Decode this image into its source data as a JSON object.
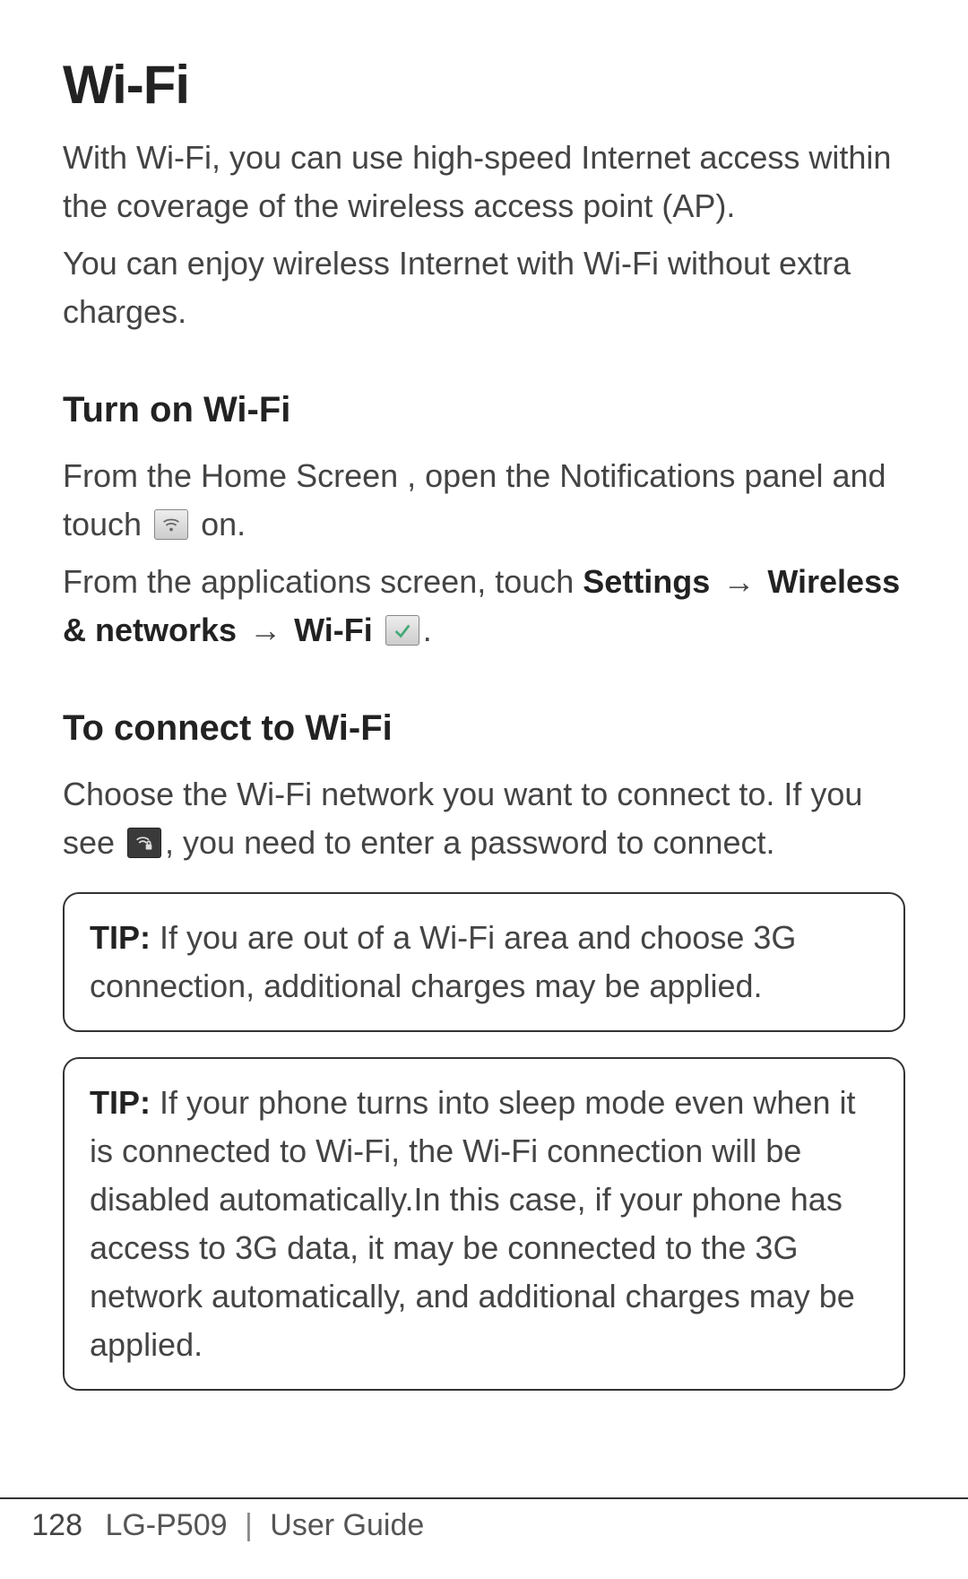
{
  "title": "Wi-Fi",
  "intro1": "With Wi-Fi, you can use high-speed Internet access within the coverage of the wireless access point (AP).",
  "intro2": "You can enjoy wireless Internet with Wi-Fi without extra charges.",
  "section1": {
    "heading": "Turn on Wi-Fi",
    "p1a": "From the Home Screen , open the Notifications panel and touch ",
    "p1b": " on.",
    "p2a": "From the applications screen, touch ",
    "settings": "Settings",
    "arrow": "→",
    "wireless": "Wireless & networks",
    "wifi": "Wi-Fi",
    "period": "."
  },
  "section2": {
    "heading": "To connect to Wi-Fi",
    "p1a": "Choose the Wi-Fi network you want to connect to. If you see ",
    "p1b": ", you need to enter a password to connect."
  },
  "tip1": {
    "label": "TIP:",
    "text": " If you are out of a Wi-Fi area and choose 3G connection, additional charges may be applied."
  },
  "tip2": {
    "label": "TIP:",
    "text": " If your phone turns into sleep mode even when it is connected to Wi-Fi, the Wi-Fi connection will be disabled automatically.In this case, if your phone has access to 3G data, it may be connected to the 3G network automatically, and additional charges may be applied."
  },
  "footer": {
    "page": "128",
    "model": "LG-P509",
    "divider": "|",
    "doc": "User Guide"
  }
}
